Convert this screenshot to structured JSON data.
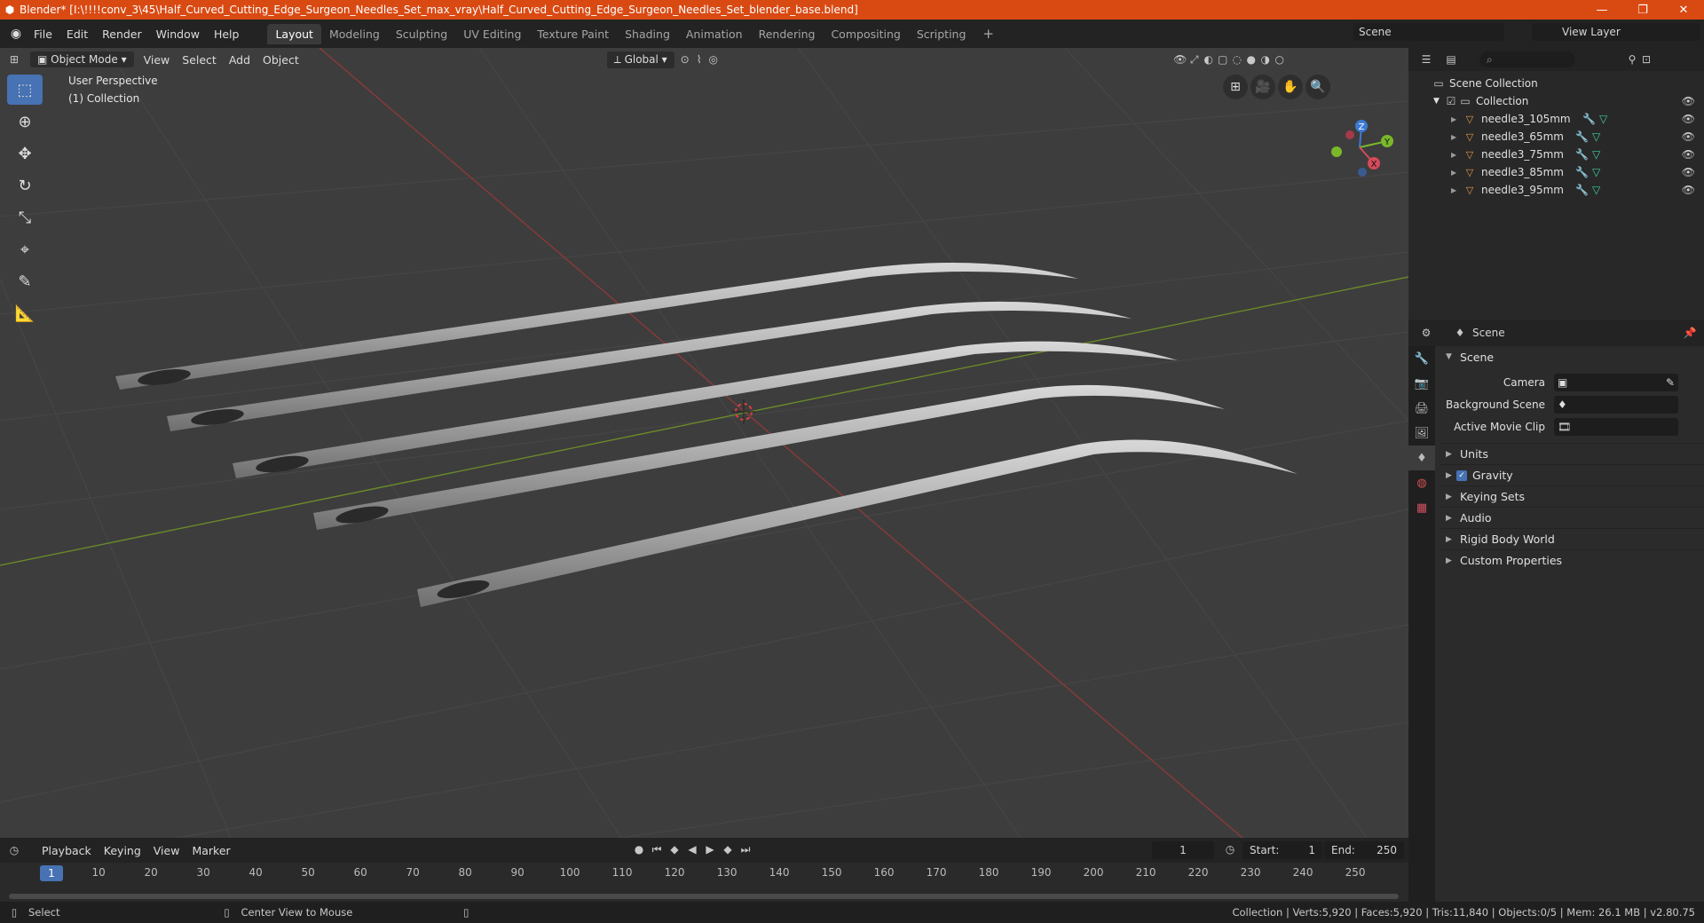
{
  "window": {
    "title": "Blender* [I:\\!!!!conv_3\\45\\Half_Curved_Cutting_Edge_Surgeon_Needles_Set_max_vray\\Half_Curved_Cutting_Edge_Surgeon_Needles_Set_blender_base.blend]",
    "minimize": "—",
    "maximize": "❐",
    "close": "✕"
  },
  "menus": [
    "File",
    "Edit",
    "Render",
    "Window",
    "Help"
  ],
  "workspaces": [
    "Layout",
    "Modeling",
    "Sculpting",
    "UV Editing",
    "Texture Paint",
    "Shading",
    "Animation",
    "Rendering",
    "Compositing",
    "Scripting"
  ],
  "active_workspace": "Layout",
  "scene_selector": "Scene",
  "view_layer": "View Layer",
  "viewport": {
    "mode": "Object Mode",
    "menus": [
      "View",
      "Select",
      "Add",
      "Object"
    ],
    "transform_orientation": "Global",
    "perspective_label": "User Perspective",
    "collection_label": "(1) Collection",
    "gizmo_axes": [
      "Z",
      "Y",
      "X"
    ]
  },
  "timeline": {
    "menus": [
      "Playback",
      "Keying",
      "View",
      "Marker"
    ],
    "current_frame": "1",
    "start_label": "Start:",
    "start": "1",
    "end_label": "End:",
    "end": "250",
    "ruler_ticks": [
      "10",
      "20",
      "30",
      "40",
      "50",
      "60",
      "70",
      "80",
      "90",
      "100",
      "110",
      "120",
      "130",
      "140",
      "150",
      "160",
      "170",
      "180",
      "190",
      "200",
      "210",
      "220",
      "230",
      "240",
      "250"
    ],
    "ruler_current": "1"
  },
  "status": {
    "select": "Select",
    "center_view": "Center View to Mouse",
    "stats": "Collection | Verts:5,920 | Faces:5,920 | Tris:11,840 | Objects:0/5 | Mem: 26.1 MB | v2.80.75"
  },
  "outliner": {
    "root": "Scene Collection",
    "collection": "Collection",
    "items": [
      {
        "name": "needle3_105mm"
      },
      {
        "name": "needle3_65mm"
      },
      {
        "name": "needle3_75mm"
      },
      {
        "name": "needle3_85mm"
      },
      {
        "name": "needle3_95mm"
      }
    ]
  },
  "properties": {
    "header": "Scene",
    "panel": "Scene",
    "fields": [
      {
        "label": "Camera"
      },
      {
        "label": "Background Scene"
      },
      {
        "label": "Active Movie Clip"
      }
    ],
    "subpanels": [
      "Units",
      "Gravity",
      "Keying Sets",
      "Audio",
      "Rigid Body World",
      "Custom Properties"
    ]
  }
}
